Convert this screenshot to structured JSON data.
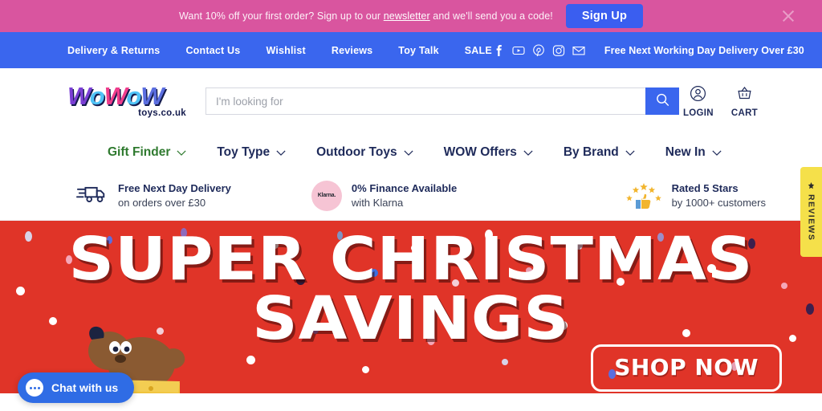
{
  "promo": {
    "text_before": "Want 10% off your first order? Sign up to our ",
    "link": "newsletter",
    "text_after": " and we'll send you a code!",
    "button": "Sign Up",
    "close_icon": "close-icon"
  },
  "topnav": {
    "links": [
      {
        "label": "Delivery & Returns"
      },
      {
        "label": "Contact Us"
      },
      {
        "label": "Wishlist"
      },
      {
        "label": "Reviews"
      },
      {
        "label": "Toy Talk"
      },
      {
        "label": "SALE"
      }
    ],
    "socials": [
      {
        "name": "facebook-icon"
      },
      {
        "name": "youtube-icon"
      },
      {
        "name": "pinterest-icon"
      },
      {
        "name": "instagram-icon"
      },
      {
        "name": "email-icon"
      }
    ],
    "delivery_note": "Free Next Working Day Delivery Over £30"
  },
  "header": {
    "logo": {
      "letters": [
        "W",
        "o",
        "W",
        "o",
        "W"
      ],
      "sub": "toys.co.uk"
    },
    "search": {
      "placeholder": "I'm looking for",
      "value": "",
      "button_icon": "search-icon"
    },
    "account": [
      {
        "label": "LOGIN",
        "icon": "user-icon"
      },
      {
        "label": "CART",
        "icon": "basket-icon"
      }
    ]
  },
  "mainmenu": {
    "items": [
      {
        "label": "Gift Finder",
        "highlight": true
      },
      {
        "label": "Toy Type",
        "highlight": false
      },
      {
        "label": "Outdoor Toys",
        "highlight": false
      },
      {
        "label": "WOW Offers",
        "highlight": false
      },
      {
        "label": "By Brand",
        "highlight": false
      },
      {
        "label": "New In",
        "highlight": false
      }
    ]
  },
  "usp": {
    "items": [
      {
        "icon": "truck-icon",
        "title": "Free Next Day Delivery",
        "subtitle": "on orders over £30"
      },
      {
        "icon": "klarna-icon",
        "badge": "Klarna.",
        "title": "0% Finance Available",
        "subtitle": "with Klarna"
      },
      {
        "icon": "thumbs-up-stars-icon",
        "title": "Rated 5 Stars",
        "subtitle": "by 1000+ customers"
      }
    ]
  },
  "hero": {
    "line1": "SUPER CHRISTMAS",
    "line2": "SAVINGS",
    "cta": "SHOP NOW",
    "background_color": "#e03428"
  },
  "reviews_tab": {
    "label": "REVIEWS",
    "icon": "star-icon",
    "color": "#f5e04a"
  },
  "chat": {
    "label": "Chat with us",
    "icon": "chat-bubble-icon",
    "color": "#2f6ce5"
  }
}
